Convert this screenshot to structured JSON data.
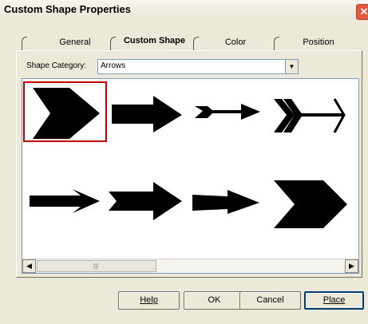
{
  "window": {
    "title": "Custom Shape Properties",
    "close_icon": "close-icon"
  },
  "tabs": [
    {
      "label": "General",
      "active": false
    },
    {
      "label": "Custom Shape",
      "active": true
    },
    {
      "label": "Color",
      "active": false
    },
    {
      "label": "Position",
      "active": false
    }
  ],
  "shape_category": {
    "label": "Shape Category:",
    "mnemonic": "S",
    "selected": "Arrows"
  },
  "shapes": [
    {
      "name": "arrow-chevron-large",
      "selected": true
    },
    {
      "name": "arrow-block"
    },
    {
      "name": "arrow-feathered"
    },
    {
      "name": "arrow-triple-chevron-line"
    },
    {
      "name": "arrow-line"
    },
    {
      "name": "arrow-notched"
    },
    {
      "name": "arrow-tapered"
    },
    {
      "name": "arrow-pentagon"
    }
  ],
  "buttons": {
    "help": "Help",
    "ok": "OK",
    "cancel": "Cancel",
    "place": "Place"
  },
  "colors": {
    "selection_border": "#C00000",
    "title_bar": "#F7F6F0",
    "dialog_bg": "#ECE9D8"
  }
}
